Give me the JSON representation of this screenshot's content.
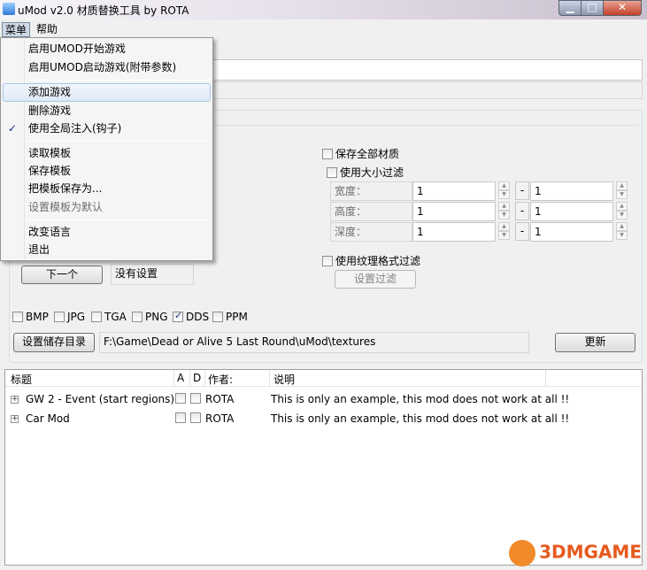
{
  "window": {
    "title": "uMod v2.0 材质替换工具 by ROTA",
    "min_label": "▁",
    "max_label": "□",
    "close_label": "✕"
  },
  "menubar": {
    "menu": "菜单",
    "help": "帮助"
  },
  "dropdown": {
    "items": [
      {
        "label": "启用UMOD开始游戏"
      },
      {
        "label": "启用UMOD启动游戏(附带参数)"
      },
      {
        "label": "添加游戏"
      },
      {
        "label": "删除游戏"
      },
      {
        "label": "使用全局注入(钩子)",
        "checked": true
      },
      {
        "label": "读取模板"
      },
      {
        "label": "保存模板"
      },
      {
        "label": "把模板保存为..."
      },
      {
        "label": "设置模板为默认",
        "disabled": true
      },
      {
        "label": "改变语言"
      },
      {
        "label": "退出"
      }
    ],
    "check_glyph": "✓"
  },
  "settings": {
    "save_all_textures": "保存全部材质",
    "use_size_filter": "使用大小过滤",
    "width_label": "宽度：",
    "height_label": "高度：",
    "depth_label": "深度：",
    "width_min": "1",
    "width_max": "1",
    "height_min": "1",
    "height_max": "1",
    "depth_min": "1",
    "depth_max": "1",
    "range_dash": "-",
    "use_format_filter": "使用纹理格式过滤",
    "set_filter_button": "设置过滤",
    "next_button": "下一个",
    "no_settings": "没有设置",
    "formats": [
      {
        "label": "BMP",
        "checked": false
      },
      {
        "label": "JPG",
        "checked": false
      },
      {
        "label": "TGA",
        "checked": false
      },
      {
        "label": "PNG",
        "checked": false
      },
      {
        "label": "DDS",
        "checked": true
      },
      {
        "label": "PPM",
        "checked": false
      }
    ],
    "set_save_dir_button": "设置储存目录",
    "save_dir": "F:\\Game\\Dead or Alive 5 Last Round\\uMod\\textures",
    "update_button": "更新"
  },
  "mod_list": {
    "headers": {
      "title": "标题",
      "a": "A",
      "d": "D",
      "author": "作者:",
      "desc": "说明"
    },
    "rows": [
      {
        "title": "GW 2 - Event  (start regions)",
        "author": "ROTA",
        "desc": "This is only an example, this mod does not work at all !!"
      },
      {
        "title": "Car Mod",
        "author": "ROTA",
        "desc": "This is only an example, this mod does not work at all !!"
      }
    ],
    "expander_glyph": "+"
  },
  "watermark": "3DMGAME",
  "colors": {
    "accent": "#3a78c4",
    "close": "#c2402a"
  }
}
